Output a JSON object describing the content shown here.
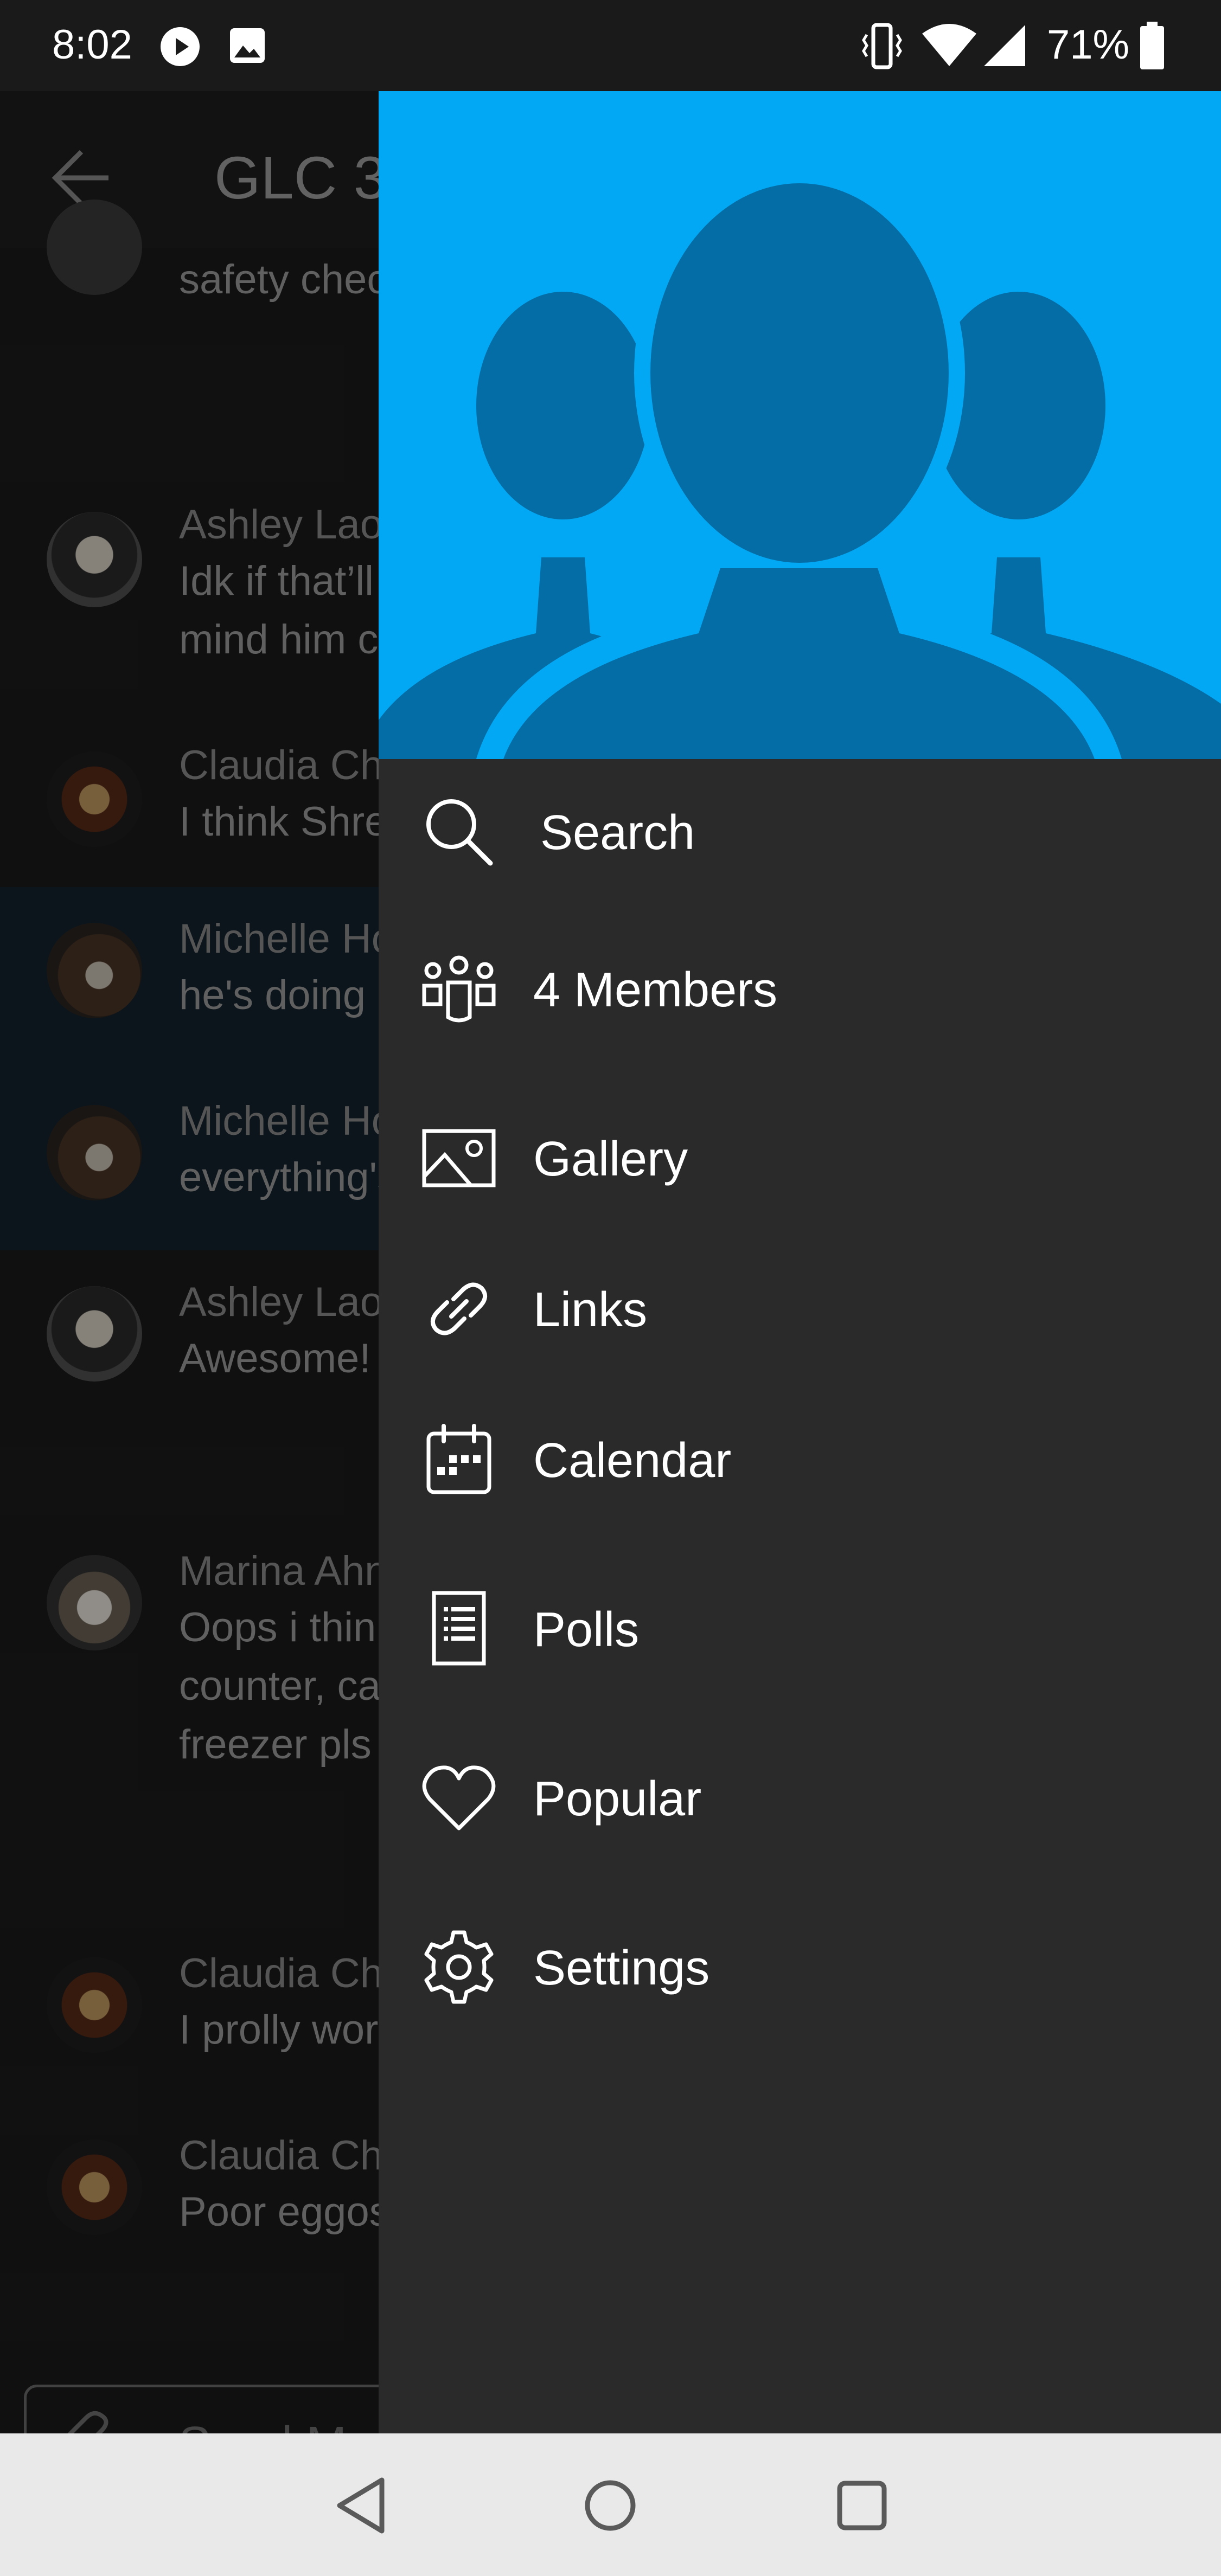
{
  "status_bar": {
    "time": "8:02",
    "battery": "71%",
    "icons": [
      "play-icon",
      "image-icon",
      "vibrate-icon",
      "wifi-icon",
      "signal-icon",
      "battery-icon"
    ]
  },
  "chat": {
    "title": "GLC 3",
    "composer_placeholder": "Send Mes",
    "messages": [
      {
        "name": "",
        "lines": [
          "safety chec"
        ],
        "highlight": false
      },
      {
        "name": "Ashley Lao",
        "lines": [
          "Idk if that’ll",
          "mind him c"
        ],
        "highlight": false
      },
      {
        "name": "Claudia Ch",
        "lines": [
          "I think Shre"
        ],
        "highlight": false
      },
      {
        "name": "Michelle Ho",
        "lines": [
          "he's doing r"
        ],
        "highlight": true
      },
      {
        "name": "Michelle Ho",
        "lines": [
          "everything's"
        ],
        "highlight": true
      },
      {
        "name": "Ashley Lao",
        "lines": [
          "Awesome!"
        ],
        "highlight": false
      },
      {
        "name": "Marina Ahn",
        "lines": [
          "Oops i think",
          "counter, ca",
          "freezer pls"
        ],
        "highlight": false
      },
      {
        "name": "Claudia Ch",
        "lines": [
          "I prolly wor"
        ],
        "highlight": false
      },
      {
        "name": "Claudia Ch",
        "lines": [
          "Poor eggos"
        ],
        "highlight": false
      }
    ]
  },
  "drawer": {
    "header_color": "#03a8f4",
    "items": [
      {
        "label": "Search",
        "icon": "search-icon"
      },
      {
        "label": "4 Members",
        "icon": "members-icon"
      },
      {
        "label": "Gallery",
        "icon": "gallery-icon"
      },
      {
        "label": "Links",
        "icon": "link-icon"
      },
      {
        "label": "Calendar",
        "icon": "calendar-icon"
      },
      {
        "label": "Polls",
        "icon": "polls-icon"
      },
      {
        "label": "Popular",
        "icon": "heart-icon"
      },
      {
        "label": "Settings",
        "icon": "gear-icon"
      }
    ]
  },
  "nav_bar": {
    "buttons": [
      "back-triangle-icon",
      "home-circle-icon",
      "recents-square-icon"
    ]
  }
}
